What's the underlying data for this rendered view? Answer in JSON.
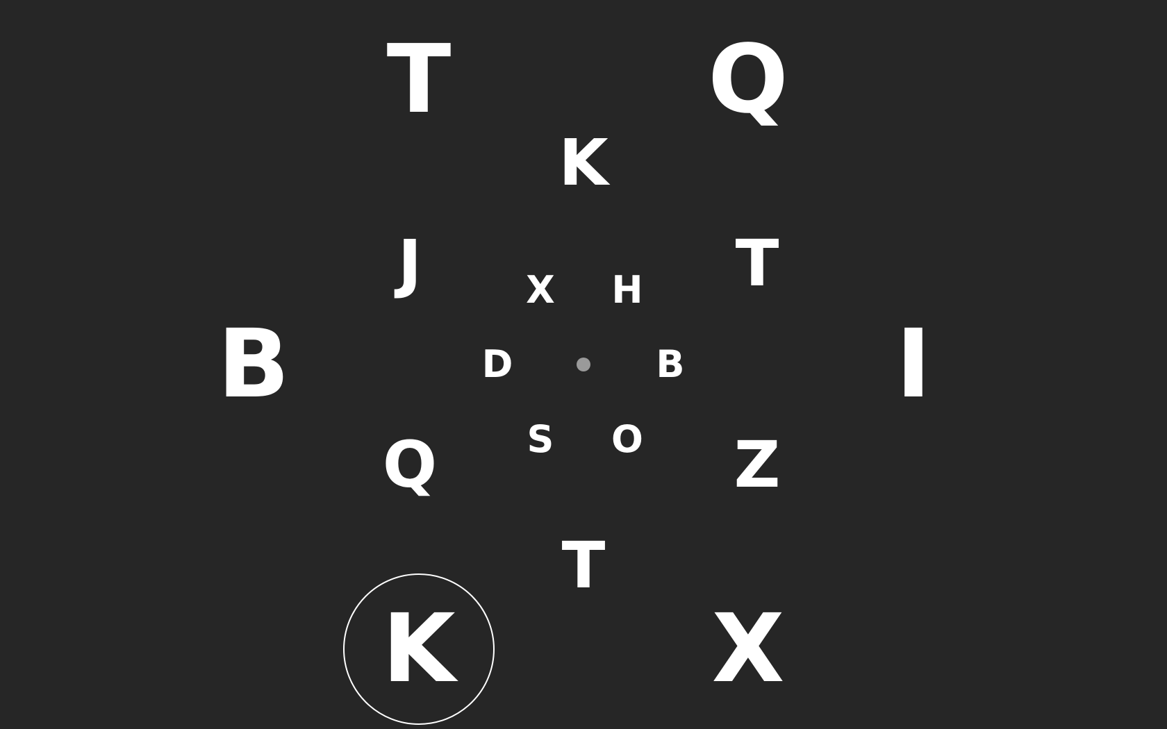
{
  "colors": {
    "background": "#262626",
    "letter": "#ffffff",
    "center_dot": "#9a9a9a",
    "ring": "#ffffff"
  },
  "letters": {
    "outer": [
      "T",
      "Q",
      "B",
      "I",
      "K",
      "X"
    ],
    "middle": [
      "K",
      "J",
      "T",
      "Q",
      "Z",
      "T"
    ],
    "inner": [
      "X",
      "H",
      "D",
      "B",
      "S",
      "O"
    ]
  },
  "selected": "K"
}
